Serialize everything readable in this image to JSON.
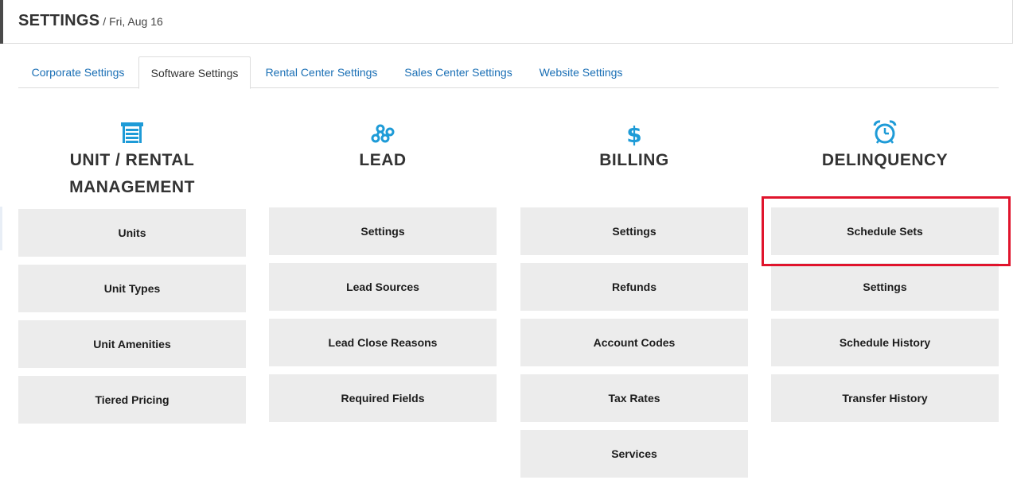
{
  "header": {
    "title": "SETTINGS",
    "date": " / Fri, Aug 16"
  },
  "tabs": [
    {
      "label": "Corporate Settings"
    },
    {
      "label": "Software Settings"
    },
    {
      "label": "Rental Center Settings"
    },
    {
      "label": "Sales Center Settings"
    },
    {
      "label": "Website Settings"
    }
  ],
  "active_tab": "Software Settings",
  "accent_color": "#1e9bd7",
  "columns": [
    {
      "title_line1": "UNIT / RENTAL",
      "title_line2": "MANAGEMENT",
      "icon": "garage-door-icon",
      "items": [
        "Units",
        "Unit Types",
        "Unit Amenities",
        "Tiered Pricing"
      ]
    },
    {
      "title_line1": "LEAD",
      "icon": "network-nodes-icon",
      "items": [
        "Settings",
        "Lead Sources",
        "Lead Close Reasons",
        "Required Fields"
      ]
    },
    {
      "title_line1": "BILLING",
      "icon": "dollar-icon",
      "items": [
        "Settings",
        "Refunds",
        "Account Codes",
        "Tax Rates",
        "Services"
      ]
    },
    {
      "title_line1": "DELINQUENCY",
      "icon": "alarm-clock-icon",
      "items": [
        "Schedule Sets",
        "Settings",
        "Schedule History",
        "Transfer History"
      ]
    }
  ],
  "highlight_color": "#e0142c"
}
